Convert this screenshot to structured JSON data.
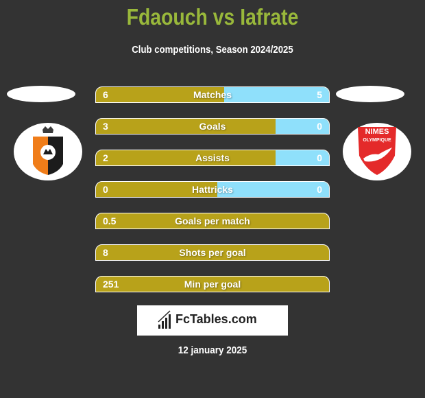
{
  "header": {
    "title": "Fdaouch vs Iafrate",
    "subtitle": "Club competitions, Season 2024/2025"
  },
  "teams": {
    "left": {
      "logo": "shield-orange-black-crown-logo"
    },
    "right": {
      "logo": "nimes-olympique-logo",
      "logo_text_top": "NIMES",
      "logo_text_bottom": "OLYMPIQUE"
    }
  },
  "colors": {
    "left_bar": "#b8a21a",
    "right_bar": "#8fe0fb",
    "title": "#99b83b",
    "background": "#333333"
  },
  "stats": [
    {
      "label": "Matches",
      "left": "6",
      "right": "5",
      "right_share": 0.45
    },
    {
      "label": "Goals",
      "left": "3",
      "right": "0",
      "right_share": 0.23
    },
    {
      "label": "Assists",
      "left": "2",
      "right": "0",
      "right_share": 0.23
    },
    {
      "label": "Hattricks",
      "left": "0",
      "right": "0",
      "right_share": 0.48
    },
    {
      "label": "Goals per match",
      "left": "0.5",
      "right": "",
      "right_share": 0
    },
    {
      "label": "Shots per goal",
      "left": "8",
      "right": "",
      "right_share": 0
    },
    {
      "label": "Min per goal",
      "left": "251",
      "right": "",
      "right_share": 0
    }
  ],
  "brand": {
    "name": "FcTables.com"
  },
  "date": "12 january 2025"
}
